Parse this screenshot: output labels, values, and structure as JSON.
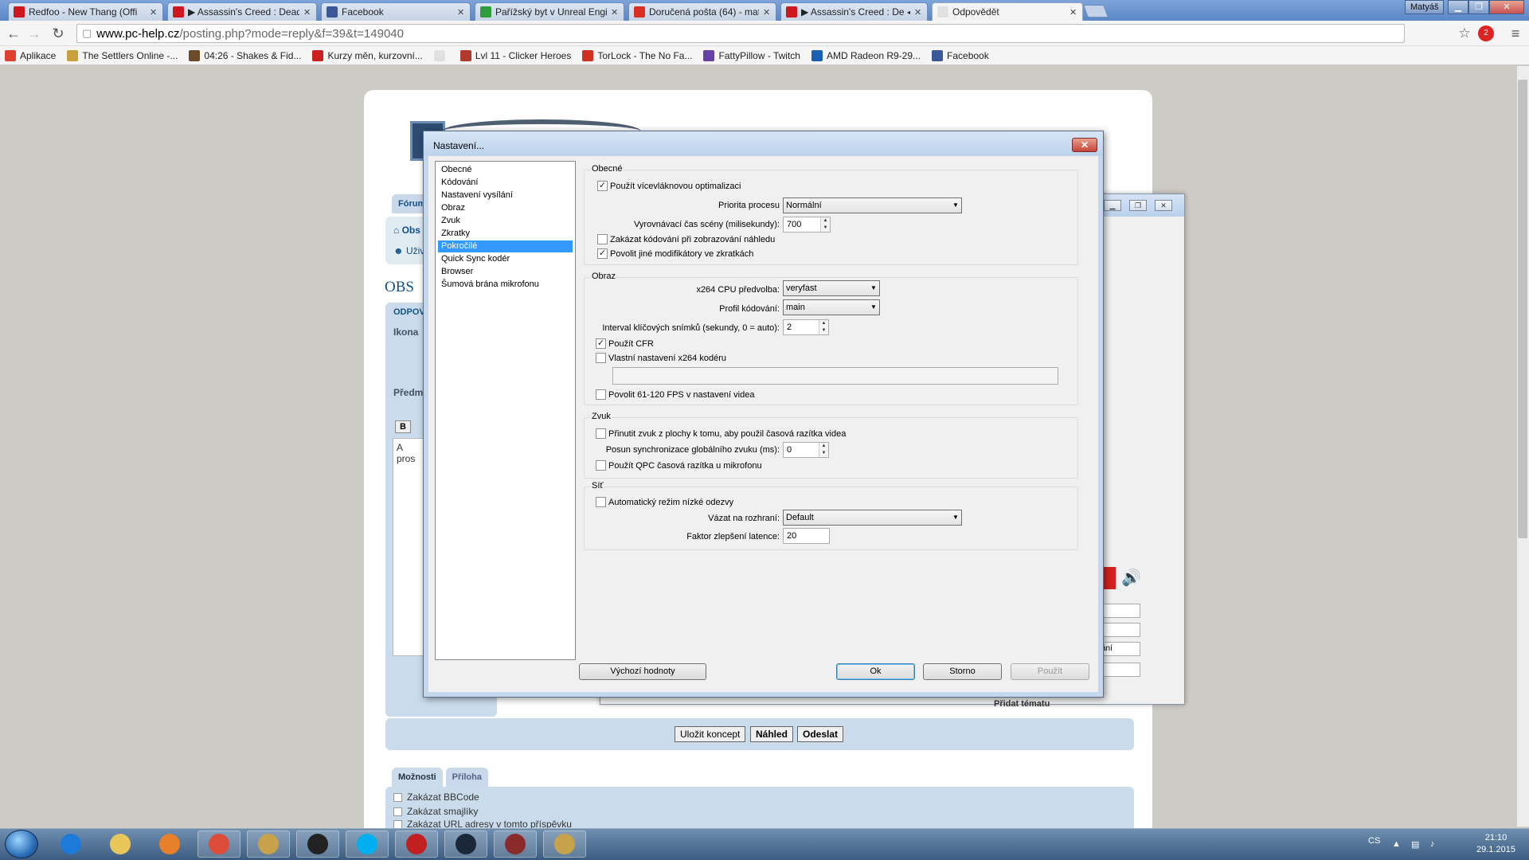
{
  "browser": {
    "tabs": [
      {
        "title": "Redfoo - New Thang (Offi",
        "favicon_color": "#cc181e"
      },
      {
        "title": "▶ Assassin's Creed : Dead",
        "favicon_color": "#cc181e"
      },
      {
        "title": "Facebook",
        "favicon_color": "#3b5998"
      },
      {
        "title": "Pařížský byt v Unreal Engi",
        "favicon_color": "#2e9e3a"
      },
      {
        "title": "Doručená pošta (64) - mat",
        "favicon_color": "#d93025"
      },
      {
        "title": "▶ Assassin's Creed : De ◀)",
        "favicon_color": "#cc181e"
      },
      {
        "title": "Odpovědět",
        "favicon_color": "#e0e0e0"
      }
    ],
    "user_badge": "Matyáš",
    "window_buttons": {
      "minimize": "▁",
      "restore": "❐",
      "close": "✕"
    },
    "url_host": "www.pc-help.cz",
    "url_path": "/posting.php?mode=reply&f=39&t=149040",
    "bookmarks": [
      {
        "label": "Aplikace",
        "color": "#e04030"
      },
      {
        "label": "The Settlers Online -...",
        "color": "#c9a13c"
      },
      {
        "label": "04:26 - Shakes & Fid...",
        "color": "#6b4b2a"
      },
      {
        "label": "Kurzy měn, kurzovní...",
        "color": "#cc2020"
      },
      {
        "label": "",
        "color": "#e0e0e0"
      },
      {
        "label": "Lvl 11 - Clicker Heroes",
        "color": "#b03a2e"
      },
      {
        "label": "TorLock - The No Fa...",
        "color": "#d03020"
      },
      {
        "label": "FattyPillow - Twitch",
        "color": "#6441a5"
      },
      {
        "label": "AMD Radeon R9-29...",
        "color": "#1a5fb4"
      },
      {
        "label": "Facebook",
        "color": "#3b5998"
      }
    ],
    "notif_count": "2"
  },
  "forum": {
    "tab_label": "Fórum",
    "nav": [
      "Obs",
      "Uživ"
    ],
    "page_title": "OBS",
    "reply_link": "ODPOV",
    "icon_label": "Ikona",
    "subject_label": "Předm",
    "bold_btn": "B",
    "editor_text": "A pros",
    "buttons": {
      "save_draft": "Uložit koncept",
      "preview": "Náhled",
      "submit": "Odeslat"
    },
    "option_tabs": [
      "Možnosti",
      "Příloha"
    ],
    "options": [
      "Zakázat BBCode",
      "Zakázat smajlíky",
      "Zakázat URL adresy v tomto příspěvku"
    ],
    "partial_text": "Přidat tématu"
  },
  "obs_main": {
    "partial_fields": [
      "t",
      "t",
      "ání"
    ]
  },
  "dialog": {
    "title": "Nastavení...",
    "close": "✕",
    "categories": [
      "Obecné",
      "Kódování",
      "Nastavení vysílání",
      "Obraz",
      "Zvuk",
      "Zkratky",
      "Pokročilé",
      "Quick Sync kodér",
      "Browser",
      "Šumová brána mikrofonu"
    ],
    "selected_category": "Pokročilé",
    "general": {
      "group": "Obecné",
      "multithread": "Použít vícevláknovou optimalizaci",
      "priority_label": "Priorita procesu",
      "priority_value": "Normální",
      "scene_buffer_label": "Vyrovnávací čas scény (milisekundy):",
      "scene_buffer_value": "700",
      "disable_preview_encoding": "Zakázat kódování při zobrazování náhledu",
      "allow_modifiers": "Povolit jiné modifikátory ve zkratkách"
    },
    "video": {
      "group": "Obraz",
      "preset_label": "x264 CPU předvolba:",
      "preset_value": "veryfast",
      "profile_label": "Profil kódování:",
      "profile_value": "main",
      "keyframe_label": "Interval klíčových snímků (sekundy, 0 = auto):",
      "keyframe_value": "2",
      "use_cfr": "Použít CFR",
      "custom_x264": "Vlastní nastavení x264 kodéru",
      "custom_x264_value": "",
      "allow_high_fps": "Povolit 61-120 FPS v nastavení videa"
    },
    "audio": {
      "group": "Zvuk",
      "force_timestamps": "Přinutit zvuk z plochy k tomu, aby použil časová razítka videa",
      "sync_offset_label": "Posun synchronizace globálního zvuku  (ms):",
      "sync_offset_value": "0",
      "use_qpc": "Použít QPC časová razítka u mikrofonu"
    },
    "network": {
      "group": "Síť",
      "low_latency": "Automatický režim nízké odezvy",
      "bind_label": "Vázat na rozhraní:",
      "bind_value": "Default",
      "latency_factor_label": "Faktor zlepšení latence:",
      "latency_factor_value": "20"
    },
    "checks": {
      "multithread": true,
      "disable_preview_encoding": false,
      "allow_modifiers": true,
      "use_cfr": true,
      "custom_x264": false,
      "allow_high_fps": false,
      "force_timestamps": false,
      "use_qpc": false,
      "low_latency": false
    },
    "buttons": {
      "defaults": "Výchozí hodnoty",
      "ok": "Ok",
      "cancel": "Storno",
      "apply": "Použít"
    }
  },
  "taskbar": {
    "apps": [
      {
        "name": "internet-explorer",
        "color": "#1e7ad8"
      },
      {
        "name": "explorer",
        "color": "#e8c65a"
      },
      {
        "name": "media-player",
        "color": "#e8802a"
      },
      {
        "name": "chrome",
        "color": "#dd4b39"
      },
      {
        "name": "league-of-legends",
        "color": "#c8a24a"
      },
      {
        "name": "obs",
        "color": "#222222"
      },
      {
        "name": "skype",
        "color": "#00aff0"
      },
      {
        "name": "app-red",
        "color": "#c02020"
      },
      {
        "name": "steam",
        "color": "#1b2838"
      },
      {
        "name": "app-box",
        "color": "#8a2a2a"
      },
      {
        "name": "league-of-legends-2",
        "color": "#c8a24a"
      }
    ],
    "lang": "CS",
    "time": "21:10",
    "date": "29.1.2015"
  }
}
